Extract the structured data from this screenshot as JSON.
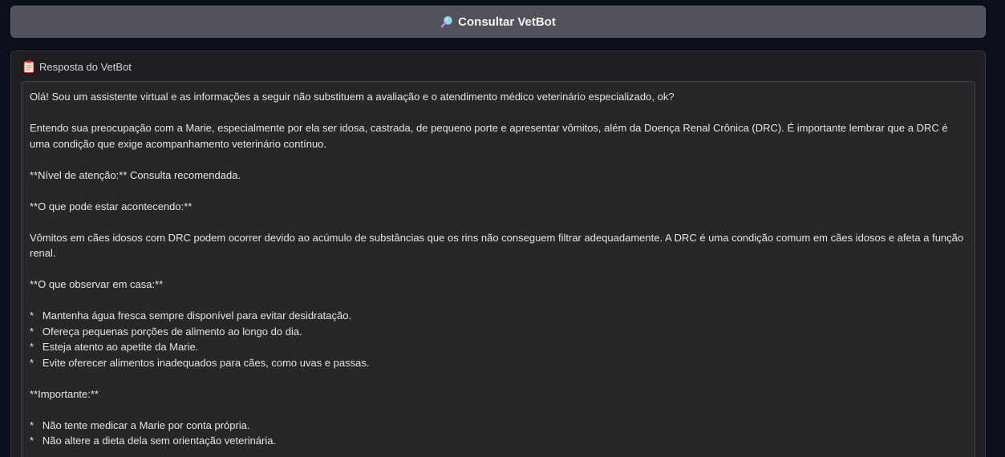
{
  "consult_button": {
    "icon": "magnifier-icon",
    "label": "Consultar VetBot"
  },
  "response_panel": {
    "icon": "clipboard-icon",
    "title": "Resposta do VetBot",
    "lines": [
      "Olá! Sou um assistente virtual e as informações a seguir não substituem a avaliação e o atendimento médico veterinário especializado, ok?",
      "",
      "Entendo sua preocupação com a Marie, especialmente por ela ser idosa, castrada, de pequeno porte e apresentar vômitos, além da Doença Renal Crônica (DRC). É importante lembrar que a DRC é uma condição que exige acompanhamento veterinário contínuo.",
      "",
      "**Nível de atenção:** Consulta recomendada.",
      "",
      "**O que pode estar acontecendo:**",
      "",
      "Vômitos em cães idosos com DRC podem ocorrer devido ao acúmulo de substâncias que os rins não conseguem filtrar adequadamente. A DRC é uma condição comum em cães idosos e afeta a função renal.",
      "",
      "**O que observar em casa:**",
      "",
      "*   Mantenha água fresca sempre disponível para evitar desidratação.",
      "*   Ofereça pequenas porções de alimento ao longo do dia.",
      "*   Esteja atento ao apetite da Marie.",
      "*   Evite oferecer alimentos inadequados para cães, como uvas e passas.",
      "",
      "**Importante:**",
      "",
      "*   Não tente medicar a Marie por conta própria.",
      "*   Não altere a dieta dela sem orientação veterinária."
    ]
  }
}
